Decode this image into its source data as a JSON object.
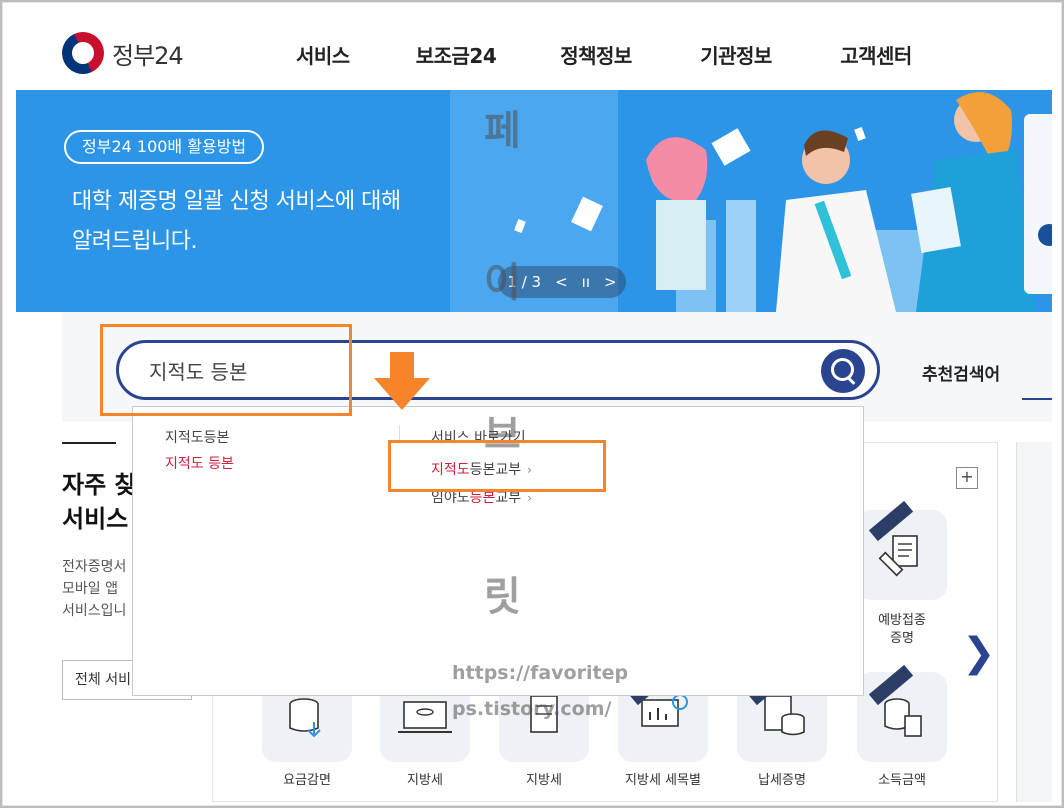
{
  "header": {
    "logo_text": "정부24",
    "nav": [
      "서비스",
      "보조금24",
      "정책정보",
      "기관정보",
      "고객센터"
    ]
  },
  "banner": {
    "pill": "정부24 100배 활용방법",
    "title_line1": "대학 제증명 일괄 신청 서비스에 대해",
    "title_line2": "알려드립니다.",
    "pager": {
      "count": "1 / 3",
      "prev": "<",
      "pause": "ıı",
      "next": ">"
    }
  },
  "search": {
    "value": "지적도 등본",
    "recommended_label": "추천검색어"
  },
  "dropdown": {
    "left_items": [
      "지적도등본",
      "지적도 등본"
    ],
    "section_title": "서비스 바로가기",
    "link1": {
      "match": "지적도",
      "rest": "등본교부"
    },
    "link2": {
      "pre": "임야도",
      "match": "등본",
      "rest": "교부"
    }
  },
  "left_section": {
    "title_line1": "자주 찾",
    "title_line2": "서비스",
    "desc_line1": "전자증명서",
    "desc_line2": "모바일 앱",
    "desc_line3": "서비스입니",
    "button": "전체 서비"
  },
  "services": [
    {
      "label_line1": "예방접종",
      "label_line2": "증명"
    },
    {
      "label_line1": "요금감면",
      "label_line2": ""
    },
    {
      "label_line1": "지방세",
      "label_line2": ""
    },
    {
      "label_line1": "지방세",
      "label_line2": ""
    },
    {
      "label_line1": "지방세 세목별",
      "label_line2": ""
    },
    {
      "label_line1": "납세증명",
      "label_line2": ""
    },
    {
      "label_line1": "소득금액",
      "label_line2": ""
    }
  ],
  "watermark": {
    "chars": [
      "페",
      "이",
      "브",
      "릿"
    ],
    "url_line1": "https://favoritep",
    "url_line2": "ps.tistory.com/"
  },
  "colors": {
    "accent": "#2b4490",
    "banner": "#2d95e8",
    "highlight": "#f5842b",
    "match": "#d41f3c"
  }
}
